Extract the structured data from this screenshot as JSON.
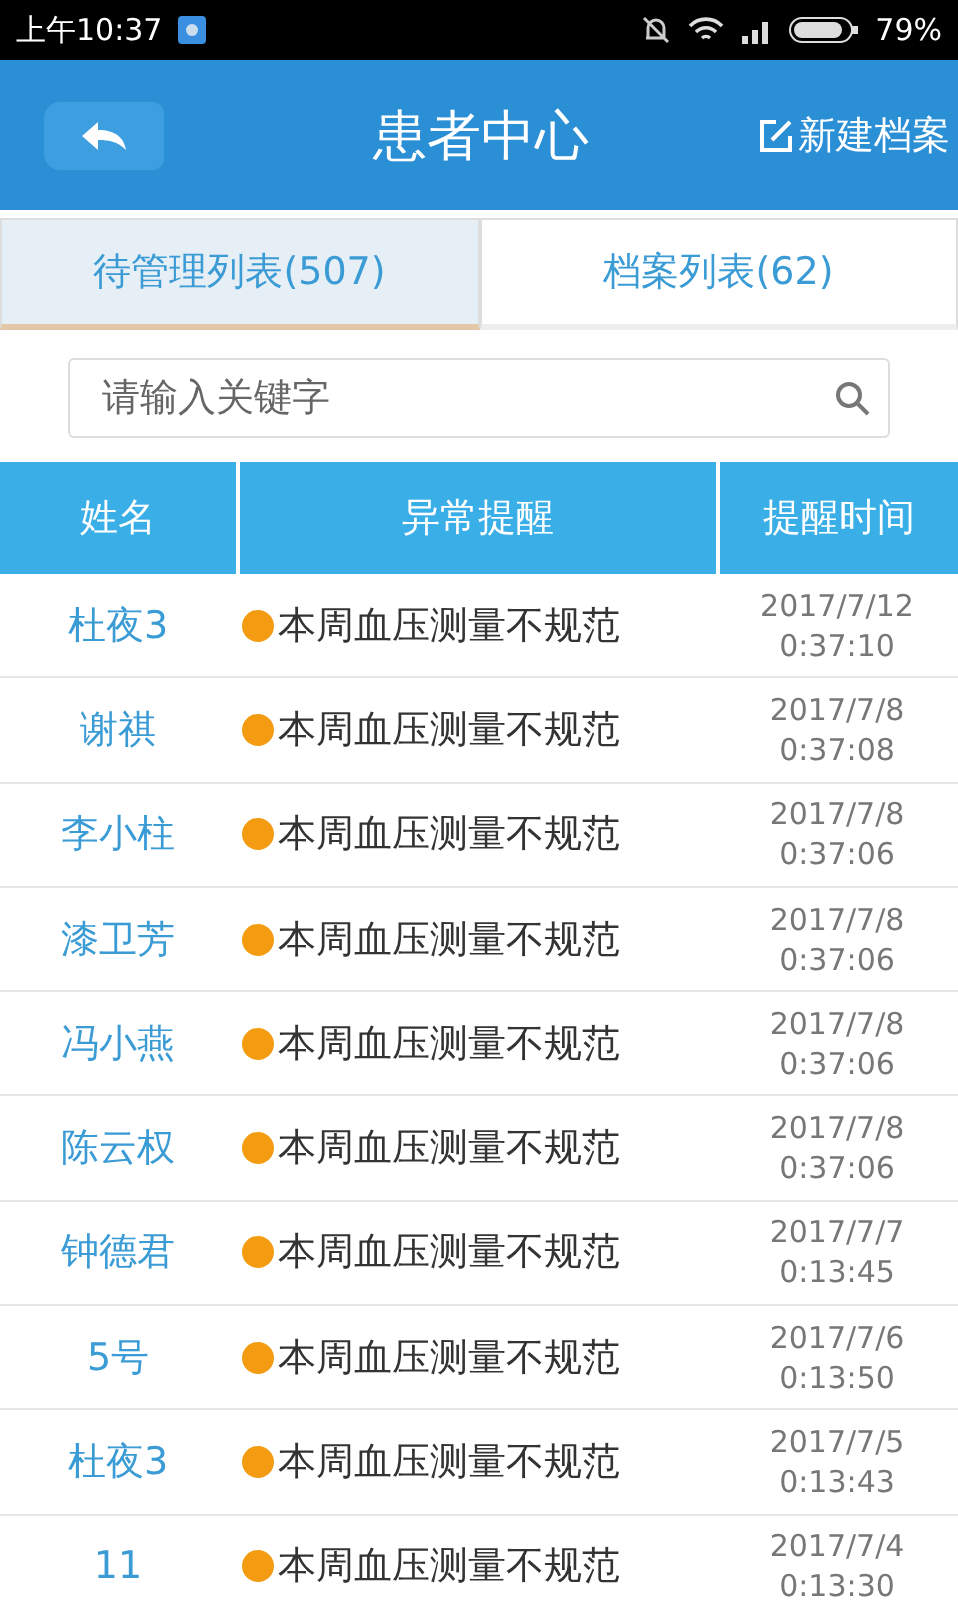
{
  "status_bar": {
    "time": "上午10:37",
    "battery": "79%"
  },
  "header": {
    "title": "患者中心",
    "action": "新建档案"
  },
  "tabs": [
    {
      "label": "待管理列表(507)",
      "selected": true
    },
    {
      "label": "档案列表(62)",
      "selected": false
    }
  ],
  "search": {
    "placeholder": "请输入关键字"
  },
  "table": {
    "columns": [
      "姓名",
      "异常提醒",
      "提醒时间"
    ],
    "rows": [
      {
        "name": "杜夜3",
        "alert": "本周血压测量不规范",
        "color": "#f39c12",
        "date": "2017/7/12",
        "time": "0:37:10"
      },
      {
        "name": "谢祺",
        "alert": "本周血压测量不规范",
        "color": "#f39c12",
        "date": "2017/7/8",
        "time": "0:37:08"
      },
      {
        "name": "李小柱",
        "alert": "本周血压测量不规范",
        "color": "#f39c12",
        "date": "2017/7/8",
        "time": "0:37:06"
      },
      {
        "name": "漆卫芳",
        "alert": "本周血压测量不规范",
        "color": "#f39c12",
        "date": "2017/7/8",
        "time": "0:37:06"
      },
      {
        "name": "冯小燕",
        "alert": "本周血压测量不规范",
        "color": "#f39c12",
        "date": "2017/7/8",
        "time": "0:37:06"
      },
      {
        "name": "陈云权",
        "alert": "本周血压测量不规范",
        "color": "#f39c12",
        "date": "2017/7/8",
        "time": "0:37:06"
      },
      {
        "name": "钟德君",
        "alert": "本周血压测量不规范",
        "color": "#f39c12",
        "date": "2017/7/7",
        "time": "0:13:45"
      },
      {
        "name": "5号",
        "alert": "本周血压测量不规范",
        "color": "#f39c12",
        "date": "2017/7/6",
        "time": "0:13:50"
      },
      {
        "name": "杜夜3",
        "alert": "本周血压测量不规范",
        "color": "#f39c12",
        "date": "2017/7/5",
        "time": "0:13:43"
      },
      {
        "name": "11",
        "alert": "本周血压测量不规范",
        "color": "#f39c12",
        "date": "2017/7/4",
        "time": "0:13:30"
      }
    ]
  }
}
